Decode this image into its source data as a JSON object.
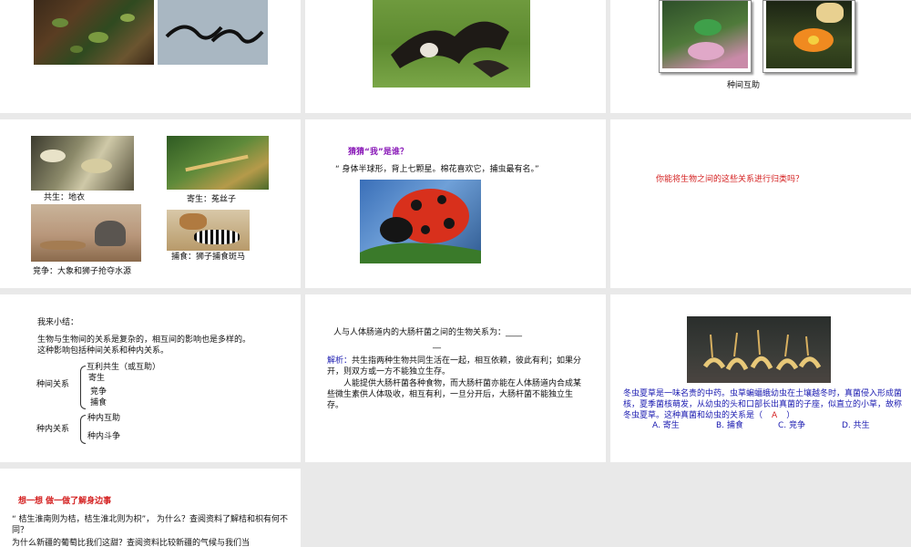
{
  "slide3": {
    "caption": "种间互助"
  },
  "slide4": {
    "items": [
      "共生：地衣",
      "寄生：菟丝子",
      "竞争：大象和狮子抢夺水源",
      "捕食：狮子捕食斑马"
    ]
  },
  "slide5": {
    "title": "猜猜“我”是谁？",
    "riddle": "“ 身体半球形，背上七颗星。棉花喜欢它，捕虫最有名。”"
  },
  "slide6": {
    "question": "你能将生物之间的这些关系进行归类吗？"
  },
  "slide7": {
    "heading": "我来小结：",
    "paragraph": "生物与生物间的关系是复杂的，相互间的影响也是多样的。这种影响包括种间关系和种内关系。",
    "inter_label": "种间关系",
    "inter_items": [
      "互利共生（或互助）",
      "寄生",
      "竞争",
      "捕食"
    ],
    "intra_label": "种内关系",
    "intra_items": [
      "种内互助",
      "种内斗争"
    ]
  },
  "slide8": {
    "question": "人与人体肠道内的大肠杆菌之间的生物关系为：____",
    "blank_tail": "__",
    "analysis_label": "解析：",
    "analysis_1": "共生指两种生物共同生活在一起，相互依赖，彼此有利；如果分开，则双方或一方不能独立生存。",
    "analysis_2": "人能提供大肠杆菌各种食物，而大肠杆菌亦能在人体肠道内合成某些微生素供人体吸收，相互有利，一旦分开后，大肠杆菌不能独立生存。"
  },
  "slide9": {
    "paragraph": "冬虫夏草是一味名贵的中药。虫草蝙蝠蛾幼虫在土壤越冬时，真菌侵入形成菌核，夏季菌核萌发，从幼虫的头和口部长出真菌的子座，似直立的小草，故称冬虫夏草。这种真菌和幼虫的关系是（",
    "answer": "A",
    "paren_close": "）",
    "options": [
      "A. 寄生",
      "B. 捕食",
      "C. 竞争",
      "D. 共生"
    ]
  },
  "slide10": {
    "title": "想一想  做一做了解身边事",
    "line1": "“ 桔生淮南则为桔，桔生淮北则为枳”，   为什么？查阅资料了解桔和枳有何不同？",
    "line2": "为什么新疆的葡萄比我们这甜？查阅资料比较新疆的气候与我们当"
  },
  "colors": {
    "red": "#d42020",
    "blue": "#1a1ab0",
    "purple": "#8a1ab8",
    "gray_bg": "#e9e9e9"
  }
}
